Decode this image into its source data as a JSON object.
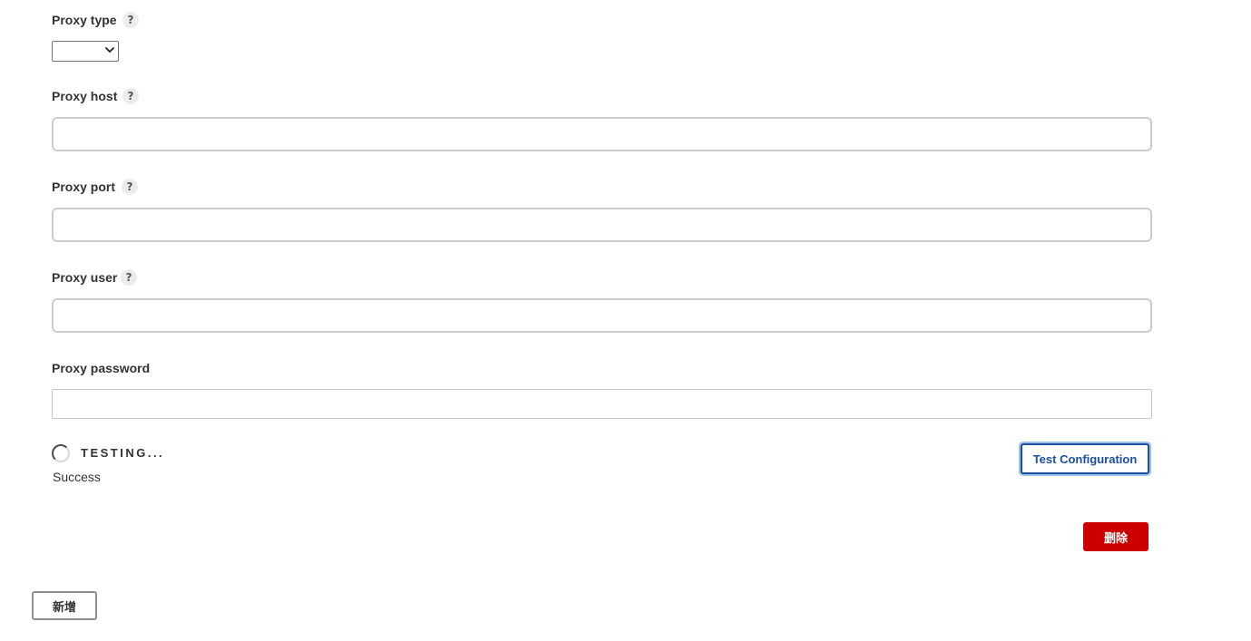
{
  "fields": {
    "proxy_type": {
      "label": "Proxy type",
      "help": "?",
      "selected": ""
    },
    "proxy_host": {
      "label": "Proxy host",
      "help": "?",
      "value": ""
    },
    "proxy_port": {
      "label": "Proxy port",
      "help": "?",
      "value": ""
    },
    "proxy_user": {
      "label": "Proxy user",
      "help": "?",
      "value": ""
    },
    "proxy_password": {
      "label": "Proxy password",
      "value": ""
    }
  },
  "status": {
    "testing_text": "TESTING...",
    "result_text": "Success"
  },
  "buttons": {
    "test_configuration": "Test Configuration",
    "delete": "删除",
    "add": "新增"
  },
  "icons": {
    "help": "help-icon",
    "spinner": "loading-spinner-icon",
    "select_chevron": "chevron-down-icon"
  },
  "colors": {
    "delete_button": "#cc0000",
    "test_button_accent": "#1c4fa0",
    "focus_ring": "#9cc0e8"
  }
}
